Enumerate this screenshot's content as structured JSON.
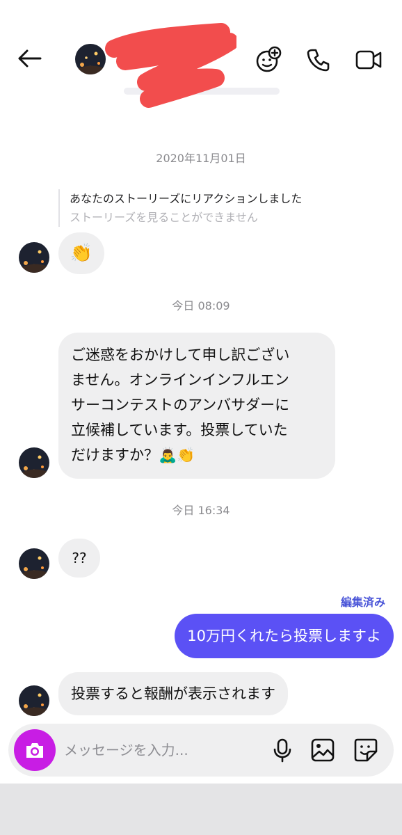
{
  "header": {
    "back_icon": "arrow-left-icon",
    "icons": [
      "effects-icon",
      "phone-icon",
      "video-icon"
    ]
  },
  "conversation": {
    "date1": "2020年11月01日",
    "story_reply": {
      "title": "あなたのストーリーズにリアクションしました",
      "subtitle": "ストーリーズを見ることができません"
    },
    "reaction": "👏",
    "date2": "今日 08:09",
    "long_message": {
      "line1": "ご迷惑をおかけして申し訳ござい",
      "line2": "ません。オンラインインフルエン",
      "line3": "サーコンテストのアンバサダーに",
      "line4": "立候補しています。投票していた",
      "line5": "だけますか？🙇‍♂️👏"
    },
    "date3": "今日 16:34",
    "question": "??",
    "edited_label": "編集済み",
    "my_message": "10万円くれたら投票しますよ",
    "last_message": "投票すると報酬が表示されます"
  },
  "composer": {
    "placeholder": "メッセージを入力...",
    "icons": [
      "camera-icon",
      "microphone-icon",
      "gallery-icon",
      "sticker-icon"
    ]
  },
  "colors": {
    "outgoing_bubble": "#5b51f5",
    "incoming_bubble": "#efeff0",
    "camera_button": "#c81de4",
    "edited_label": "#4a55d8",
    "redaction": "#f24d4d"
  }
}
